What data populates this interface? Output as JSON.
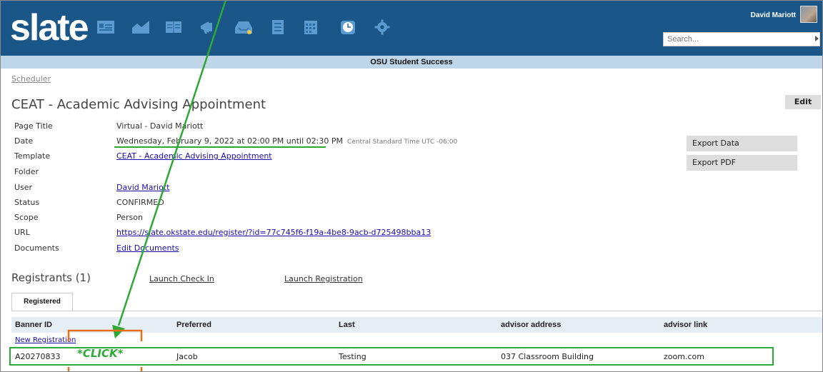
{
  "app": {
    "logo": "slate",
    "user_name": "David Mariott",
    "search_placeholder": "Search...",
    "subbar_title": "OSU Student Success"
  },
  "nav_icons": [
    "id-card-icon",
    "chart-icon",
    "book-icon",
    "megaphone-icon",
    "inbox-icon",
    "list-icon",
    "calendar-icon",
    "clock-icon",
    "gear-icon"
  ],
  "breadcrumb": "Scheduler",
  "page_title": "CEAT - Academic Advising Appointment",
  "edit_label": "Edit",
  "details": {
    "page_title_label": "Page Title",
    "page_title_value": "Virtual - David Mariott",
    "date_label": "Date",
    "date_value": "Wednesday, February 9, 2022 at 02:00 PM until 02:30 PM",
    "timezone": "Central Standard Time UTC -06:00",
    "template_label": "Template",
    "template_value": "CEAT - Academic Advising Appointment",
    "folder_label": "Folder",
    "user_label": "User",
    "user_value": "David Mariott",
    "status_label": "Status",
    "status_value": "CONFIRMED",
    "scope_label": "Scope",
    "scope_value": "Person",
    "url_label": "URL",
    "url_value": "https://slate.okstate.edu/register/?id=77c745f6-f19a-4be8-9acb-d725498bba13",
    "documents_label": "Documents",
    "documents_value": "Edit Documents"
  },
  "side_buttons": {
    "export_data": "Export Data",
    "export_pdf": "Export PDF"
  },
  "registrants": {
    "title": "Registrants (1)",
    "launch_check_in": "Launch Check In",
    "launch_registration": "Launch Registration",
    "tab_registered": "Registered",
    "columns": [
      "Banner ID",
      "Preferred",
      "Last",
      "advisor address",
      "advisor link"
    ],
    "new_registration": "New Registration",
    "rows": [
      {
        "banner_id": "A20270833",
        "preferred": "Jacob",
        "last": "Testing",
        "advisor_address": "037 Classroom Building",
        "advisor_link": "zoom.com"
      }
    ]
  },
  "annotation": {
    "click_label": "*CLICK*",
    "green": "#2ea836",
    "orange": "#e8701a"
  }
}
